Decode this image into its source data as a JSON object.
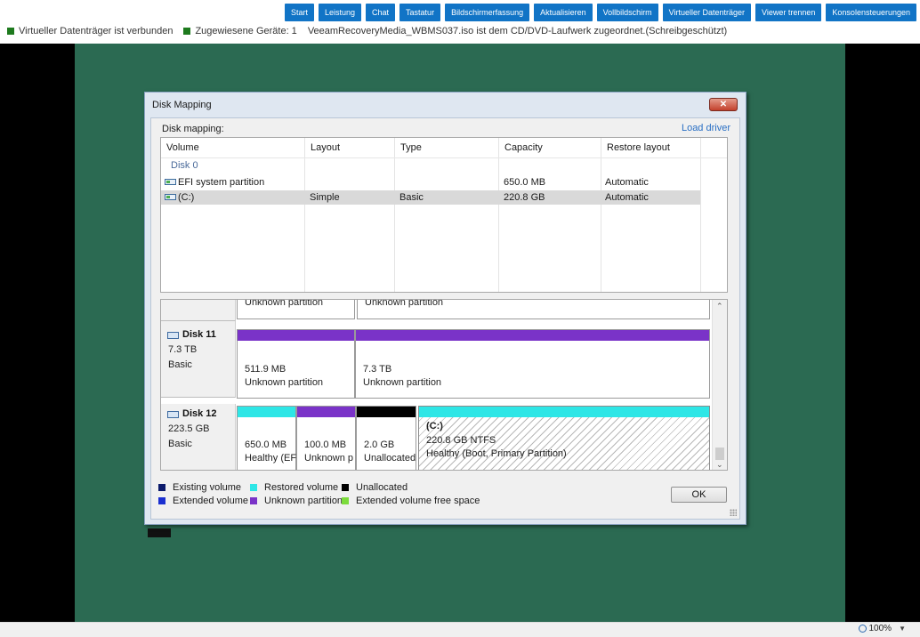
{
  "toolbar": {
    "buttons": [
      "Start",
      "Leistung",
      "Chat",
      "Tastatur",
      "Bildschirmerfassung",
      "Aktualisieren",
      "Vollbildschirm",
      "Virtueller Datenträger",
      "Viewer trennen",
      "Konsolensteuerungen"
    ],
    "button_color": "#1174c6"
  },
  "status": {
    "items": [
      {
        "text": "Virtueller Datenträger ist verbunden",
        "color": "#1e7a1e"
      },
      {
        "text": "Zugewiesene Geräte: 1",
        "color": "#1e7a1e"
      }
    ],
    "message": "VeeamRecoveryMedia_WBMS037.iso ist dem CD/DVD-Laufwerk zugeordnet.(Schreibgeschützt)"
  },
  "dialog": {
    "title": "Disk Mapping",
    "close_label": "✕",
    "mapping_label": "Disk mapping:",
    "load_driver": "Load driver",
    "ok_label": "OK",
    "columns": [
      "Volume",
      "Layout",
      "Type",
      "Capacity",
      "Restore layout"
    ],
    "disk_group": "Disk 0",
    "rows": [
      {
        "volume": "EFI system partition",
        "layout": "",
        "type": "",
        "capacity": "650.0 MB",
        "restore": "Automatic",
        "selected": false
      },
      {
        "volume": "(C:)",
        "layout": "Simple",
        "type": "Basic",
        "capacity": "220.8 GB",
        "restore": "Automatic",
        "selected": true
      }
    ]
  },
  "disks": {
    "top_partial": {
      "p1": "Unknown partition",
      "p2": "Unknown partition"
    },
    "disk11": {
      "name": "Disk 11",
      "size": "7.3 TB",
      "type": "Basic",
      "parts": [
        {
          "size": "511.9 MB",
          "desc": "Unknown partition"
        },
        {
          "size": "7.3 TB",
          "desc": "Unknown partition"
        }
      ]
    },
    "disk12": {
      "name": "Disk 12",
      "size": "223.5 GB",
      "type": "Basic",
      "parts": [
        {
          "size": "650.0 MB",
          "desc": "Healthy (EFI"
        },
        {
          "size": "100.0 MB",
          "desc": "Unknown p"
        },
        {
          "size": "2.0 GB",
          "desc": "Unallocated"
        },
        {
          "label": "(C:)",
          "size": "220.8 GB NTFS",
          "desc": "Healthy (Boot, Primary Partition)"
        }
      ]
    }
  },
  "legend": [
    {
      "label": "Existing volume",
      "color": "#0b1a6b"
    },
    {
      "label": "Restored volume",
      "color": "#2ee6e6"
    },
    {
      "label": "Unallocated",
      "color": "#000000"
    },
    {
      "label": "Extended volume",
      "color": "#1a2fd0"
    },
    {
      "label": "Unknown partition",
      "color": "#7a33c8"
    },
    {
      "label": "Extended volume free space",
      "color": "#7cdc3c"
    }
  ],
  "zoom": {
    "level": "100%"
  }
}
